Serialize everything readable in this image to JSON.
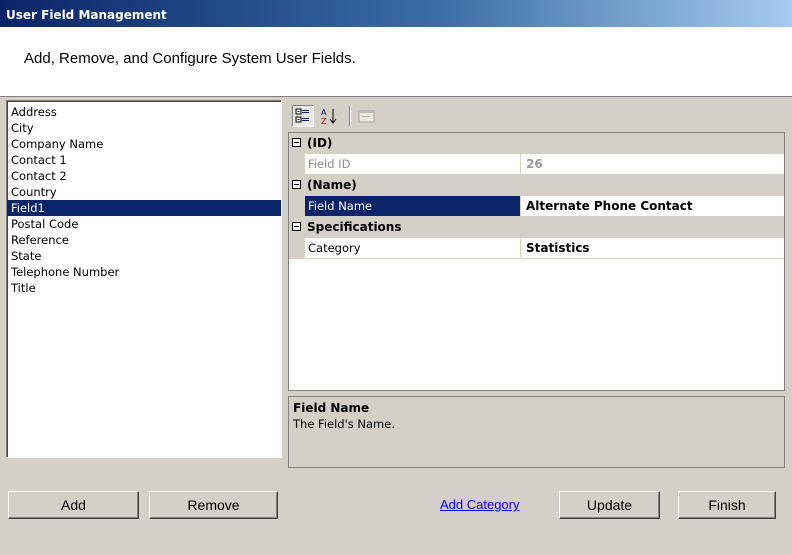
{
  "window": {
    "title": "User Field Management"
  },
  "header": {
    "subtitle": "Add, Remove, and Configure System User Fields."
  },
  "fields_list": {
    "items": [
      "Address",
      "City",
      "Company Name",
      "Contact 1",
      "Contact 2",
      "Country",
      "Field1",
      "Postal Code",
      "Reference",
      "State",
      "Telephone Number",
      "Title"
    ],
    "selected": "Field1"
  },
  "toolbar": {
    "buttons": [
      {
        "icon": "categorized-icon",
        "pressed": true
      },
      {
        "icon": "alphabetical-sort-icon",
        "pressed": false
      },
      {
        "icon": "property-pages-icon",
        "pressed": false,
        "disabled": true
      }
    ]
  },
  "property_grid": {
    "categories": [
      {
        "label": "(ID)",
        "rows": [
          {
            "name": "Field ID",
            "value": "26",
            "readonly": true
          }
        ]
      },
      {
        "label": "(Name)",
        "rows": [
          {
            "name": "Field Name",
            "value": "Alternate Phone Contact",
            "selected": true
          }
        ]
      },
      {
        "label": "Specifications",
        "rows": [
          {
            "name": "Category",
            "value": "Statistics"
          }
        ]
      }
    ]
  },
  "description": {
    "title": "Field Name",
    "text": "The Field's Name."
  },
  "buttons": {
    "add": "Add",
    "remove": "Remove",
    "add_category": "Add Category",
    "update": "Update",
    "finish": "Finish"
  },
  "colors": {
    "selection": "#0a246a",
    "title_start": "#0a246a",
    "title_end": "#a6caf0",
    "link": "#0000ee"
  }
}
